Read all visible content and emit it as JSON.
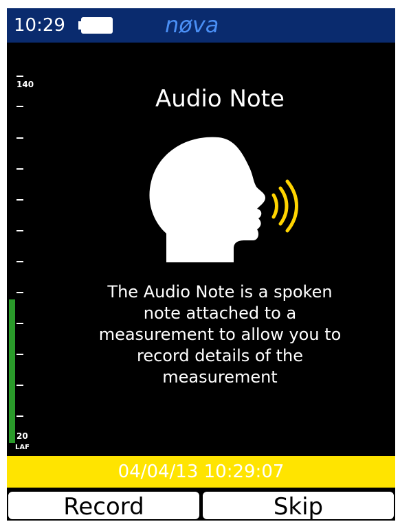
{
  "status_bar": {
    "time": "10:29",
    "brand": "nøva",
    "battery_icon": "battery-icon"
  },
  "meter": {
    "max_label": "140",
    "min_label": "20",
    "unit_label": "LAF",
    "level_fraction": 0.39,
    "bar_color": "#2a9a2a"
  },
  "main": {
    "title": "Audio Note",
    "icon": "speaking-head-icon",
    "description": "The Audio Note is a spoken\nnote attached to a\nmeasurement to allow you to\nrecord details of the\nmeasurement"
  },
  "timestamp": {
    "value": "04/04/13 10:29:07",
    "bar_color": "#ffe400"
  },
  "softkeys": {
    "left": "Record",
    "right": "Skip"
  },
  "colors": {
    "status_bar": "#0a2b6e",
    "brand": "#4a8ff5",
    "sound_waves": "#ffd400"
  }
}
